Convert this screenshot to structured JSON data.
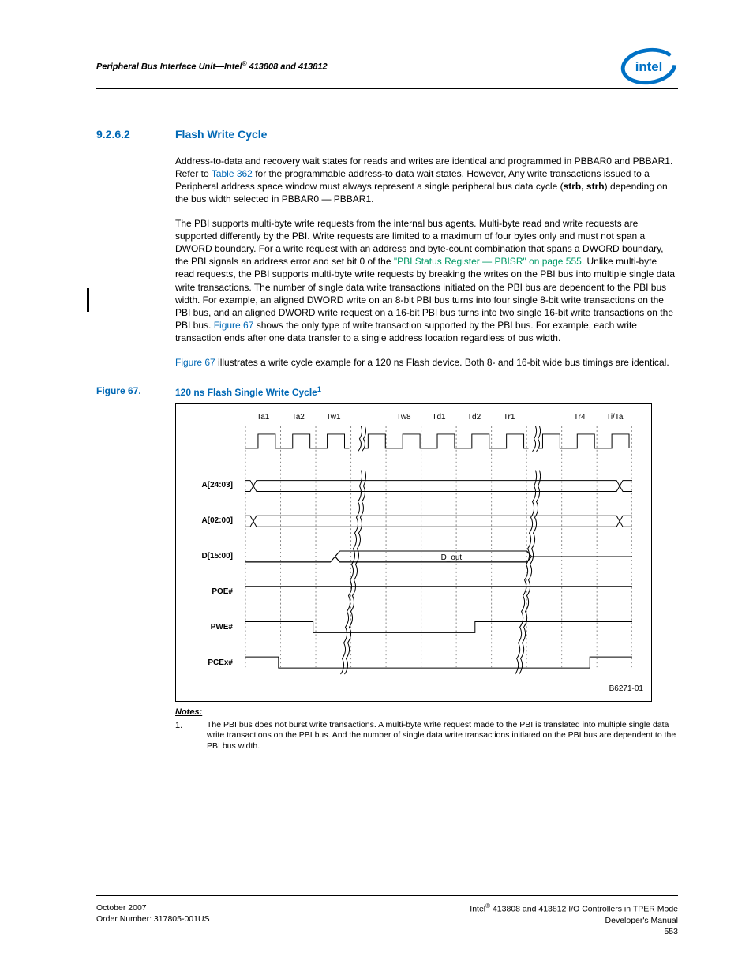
{
  "header": {
    "running_head_pre": "Peripheral Bus Interface Unit—Intel",
    "running_head_post": " 413808 and 413812"
  },
  "section": {
    "number": "9.2.6.2",
    "title": "Flash Write Cycle"
  },
  "para1": {
    "a": "Address-to-data and recovery wait states for reads and writes are identical and programmed in PBBAR0 and PBBAR1. Refer to ",
    "link1": "Table 362",
    "b": " for the programmable address-to data wait states. However, Any write transactions issued to a Peripheral address space window must always represent a single peripheral bus data cycle (",
    "bold": "strb, strh",
    "c": ") depending on the bus width selected in PBBAR0 — PBBAR1."
  },
  "para2": {
    "a": "The PBI supports multi-byte write requests from the internal bus agents. Multi-byte read and write requests are supported differently by the PBI. Write requests are limited to a maximum of four bytes only and must not span a DWORD boundary. For a write request with an address and byte-count combination that spans a DWORD boundary, the PBI signals an address error and set bit 0 of the ",
    "link_green": "\"PBI Status Register — PBISR\" on page 555",
    "b": ". Unlike multi-byte read requests, the PBI supports multi-byte write requests by breaking the writes on the PBI bus into multiple single data write transactions. The number of single data write transactions initiated on the PBI bus are dependent to the PBI bus width. For example, an aligned DWORD write on an 8-bit PBI bus turns into four single 8-bit write transactions on the PBI bus, and an aligned DWORD write request on a 16-bit PBI bus turns into two single 16-bit write transactions on the PBI bus. ",
    "link2": "Figure 67",
    "c": " shows the only type of write transaction supported by the PBI bus. For example, each write transaction ends after one data transfer to a single address location regardless of bus width."
  },
  "para3": {
    "link": "Figure 67",
    "a": " illustrates a write cycle example for a 120 ns Flash device. Both 8- and 16-bit wide bus timings are identical."
  },
  "figure": {
    "label": "Figure 67.",
    "title": "120 ns Flash Single Write Cycle",
    "sup": "1",
    "id": "B6271-01",
    "timing_cols": [
      "Ta1",
      "Ta2",
      "Tw1",
      "",
      "Tw8",
      "Td1",
      "Td2",
      "Tr1",
      "",
      "Tr4",
      "Ti/Ta"
    ],
    "signals": [
      "A[24:03]",
      "A[02:00]",
      "D[15:00]",
      "POE#",
      "PWE#",
      "PCEx#"
    ],
    "dout_label": "D_out"
  },
  "notes": {
    "heading": "Notes:",
    "n1_num": "1.",
    "n1_txt": "The PBI bus does not burst write transactions. A multi-byte write request made to the PBI is translated into multiple single data write transactions on the PBI bus. And the number of single data write transactions initiated on the PBI bus are dependent to the PBI bus width."
  },
  "footer": {
    "left1": "October 2007",
    "left2": "Order Number: 317805-001US",
    "right1_pre": "Intel",
    "right1_post": " 413808 and 413812 I/O Controllers in TPER Mode",
    "right2": "Developer's Manual",
    "right3": "553"
  }
}
